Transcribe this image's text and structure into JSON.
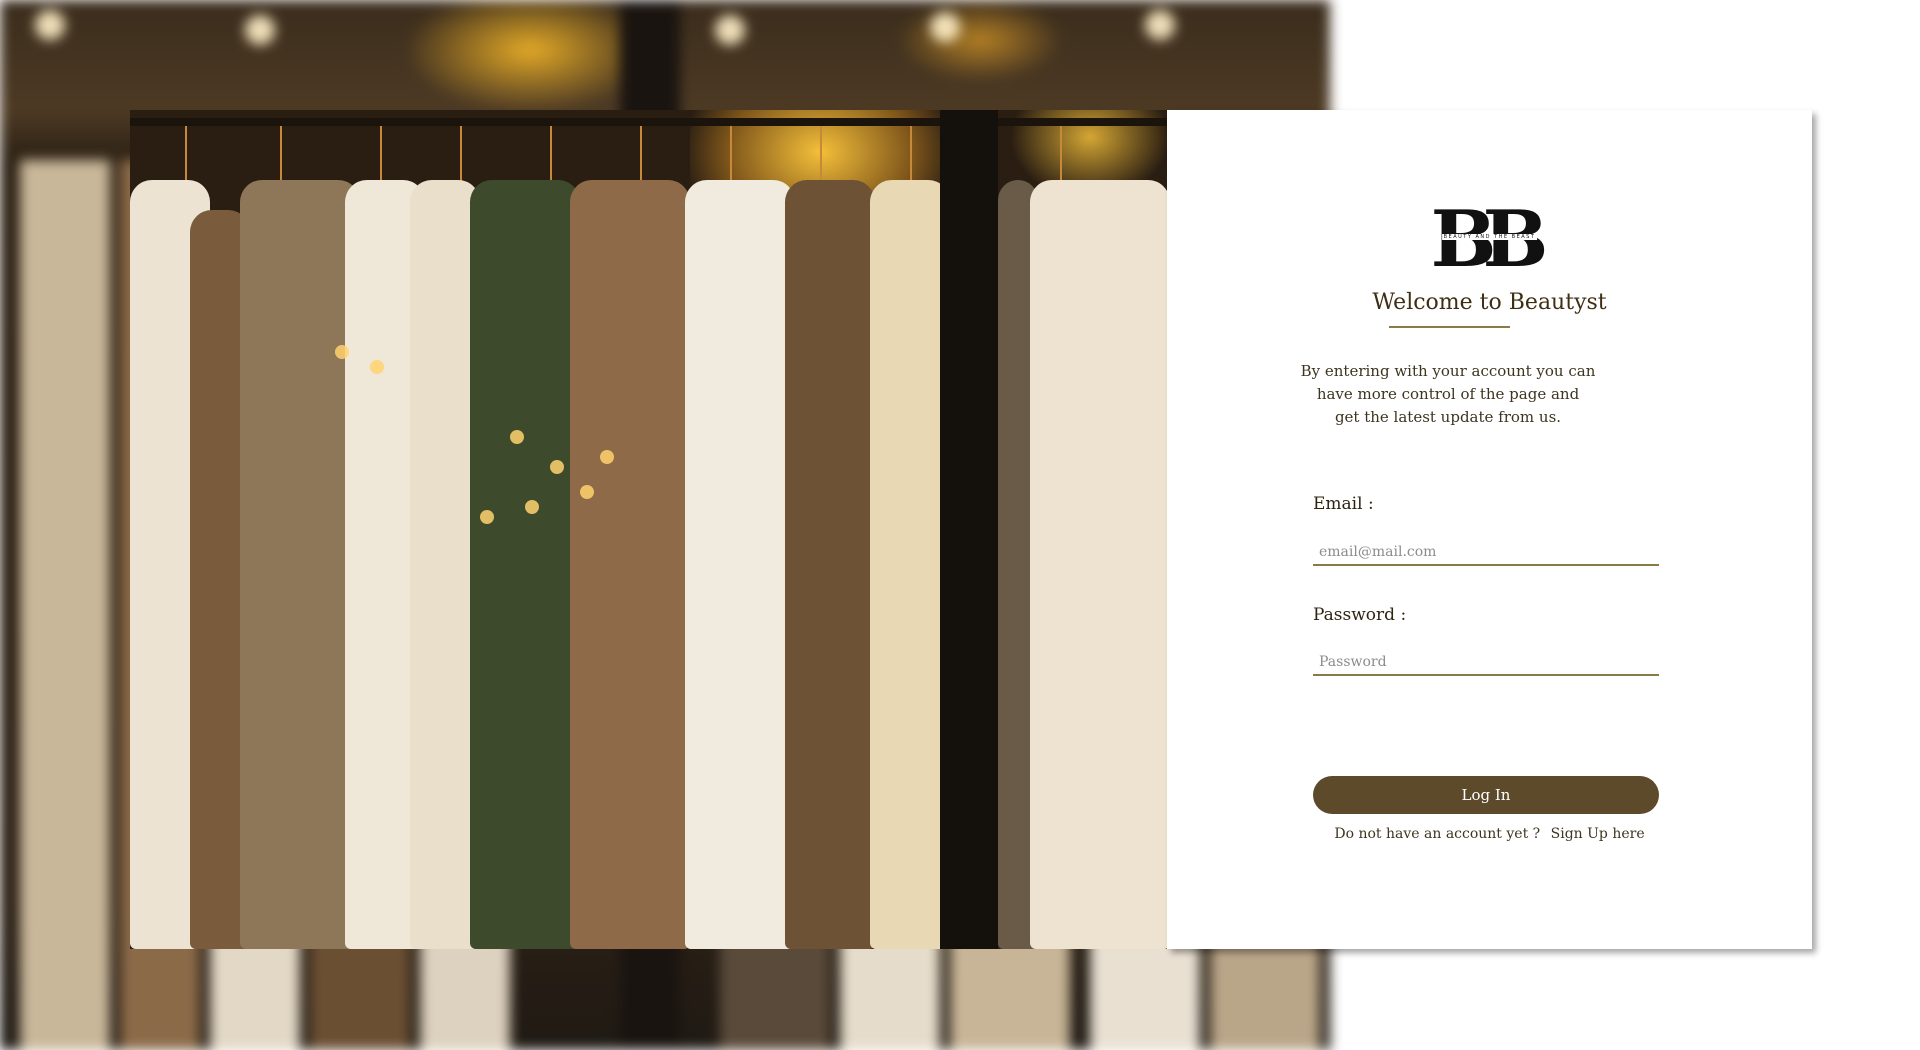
{
  "logo": {
    "mark": "BB",
    "tagline": "BEAUTY AND THE BEAST"
  },
  "welcome": {
    "title": "Welcome to Beautyst",
    "intro": "By entering with your account you can\nhave more control  of the page and\nget the latest update from us."
  },
  "form": {
    "email_label": "Email :",
    "email_placeholder": "email@mail.com",
    "email_value": "",
    "password_label": "Password :",
    "password_placeholder": "Password",
    "password_value": "",
    "login_button": "Log In",
    "signup_prompt": "Do not have an account yet ?",
    "signup_link": "Sign Up here"
  },
  "colors": {
    "accent": "#5c4a2a",
    "rule": "#8a7a48",
    "heading": "#3e2f14"
  }
}
